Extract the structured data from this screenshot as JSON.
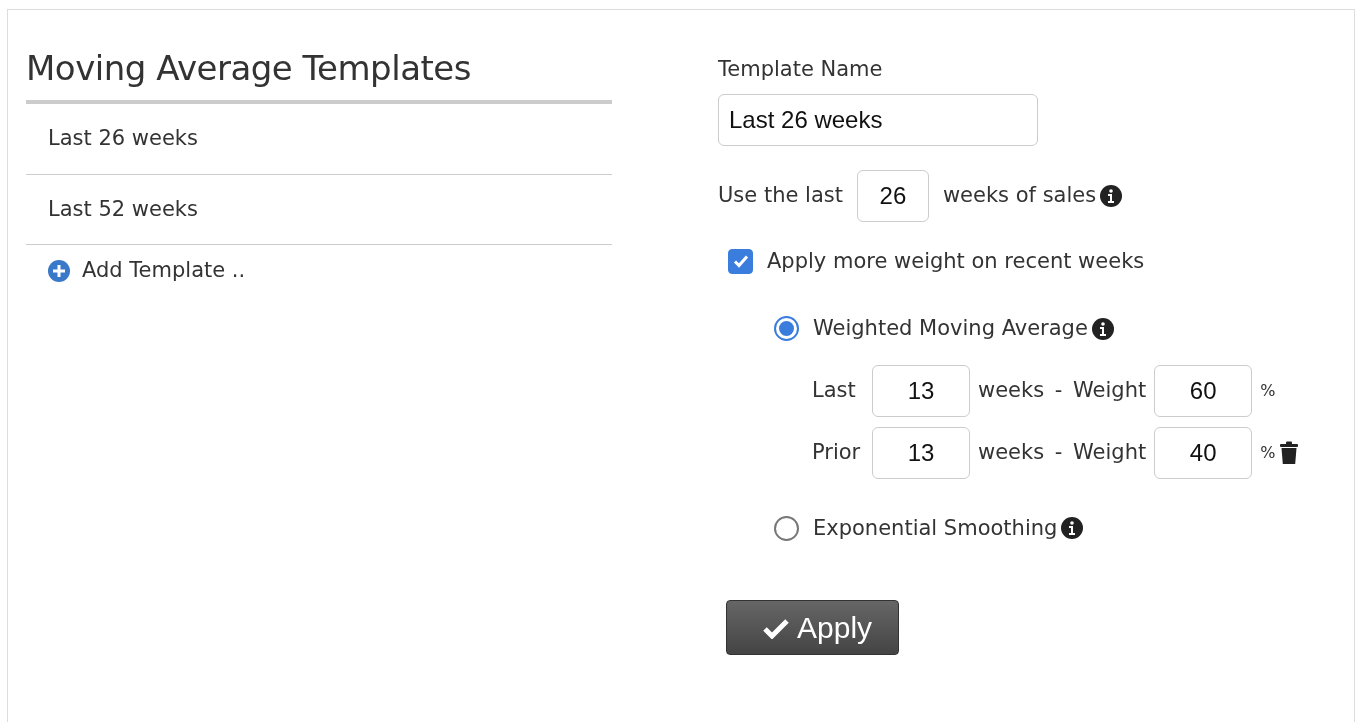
{
  "sidebar": {
    "title": "Moving Average Templates",
    "items": [
      {
        "label": "Last 26 weeks"
      },
      {
        "label": "Last 52 weeks"
      }
    ],
    "add_link": "Add Template .."
  },
  "form": {
    "name_label": "Template Name",
    "name_value": "Last 26 weeks",
    "period": {
      "prefix": "Use the last",
      "value": "26",
      "suffix": "weeks of sales"
    },
    "weighting": {
      "label": "Apply more weight on recent weeks",
      "checked": true
    },
    "methods": [
      {
        "label": "Weighted Moving Average",
        "selected": true,
        "rows": [
          {
            "label": "Last",
            "weeks": "13",
            "between": "weeks - Weight",
            "weight": "60",
            "unit": "%",
            "deletable": false
          },
          {
            "label": "Prior",
            "weeks": "13",
            "between": "weeks - Weight",
            "weight": "40",
            "unit": "%",
            "deletable": true
          }
        ]
      },
      {
        "label": "Exponential Smoothing",
        "selected": false
      }
    ],
    "apply_button": "Apply"
  }
}
